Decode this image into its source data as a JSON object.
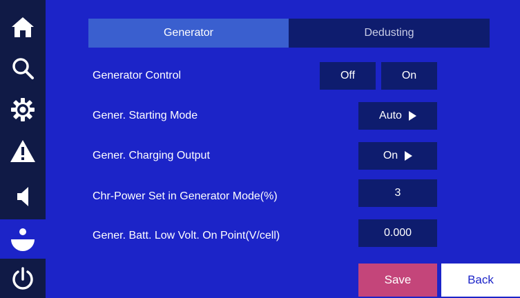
{
  "sidebar": {
    "items": [
      {
        "icon": "home-icon"
      },
      {
        "icon": "search-icon"
      },
      {
        "icon": "gear-icon"
      },
      {
        "icon": "warning-icon"
      },
      {
        "icon": "speaker-icon"
      },
      {
        "icon": "user-icon",
        "active": true
      },
      {
        "icon": "power-icon"
      }
    ]
  },
  "tabs": {
    "generator": "Generator",
    "dedusting": "Dedusting",
    "active": "generator"
  },
  "settings": {
    "generator_control": {
      "label": "Generator Control",
      "off_label": "Off",
      "on_label": "On"
    },
    "starting_mode": {
      "label": "Gener. Starting Mode",
      "value": "Auto"
    },
    "charging_output": {
      "label": "Gener. Charging Output",
      "value": "On"
    },
    "chr_power": {
      "label": "Chr-Power Set in Generator Mode(%)",
      "value": "3"
    },
    "batt_low_volt": {
      "label": "Gener. Batt. Low Volt. On Point(V/cell)",
      "value": "0.000"
    }
  },
  "buttons": {
    "save": "Save",
    "back": "Back"
  },
  "colors": {
    "background": "#1c24c8",
    "sidebar": "#101a46",
    "control": "#0e1c6e",
    "active_tab": "#3a5fcf",
    "save": "#c4457a",
    "back": "#ffffff"
  }
}
